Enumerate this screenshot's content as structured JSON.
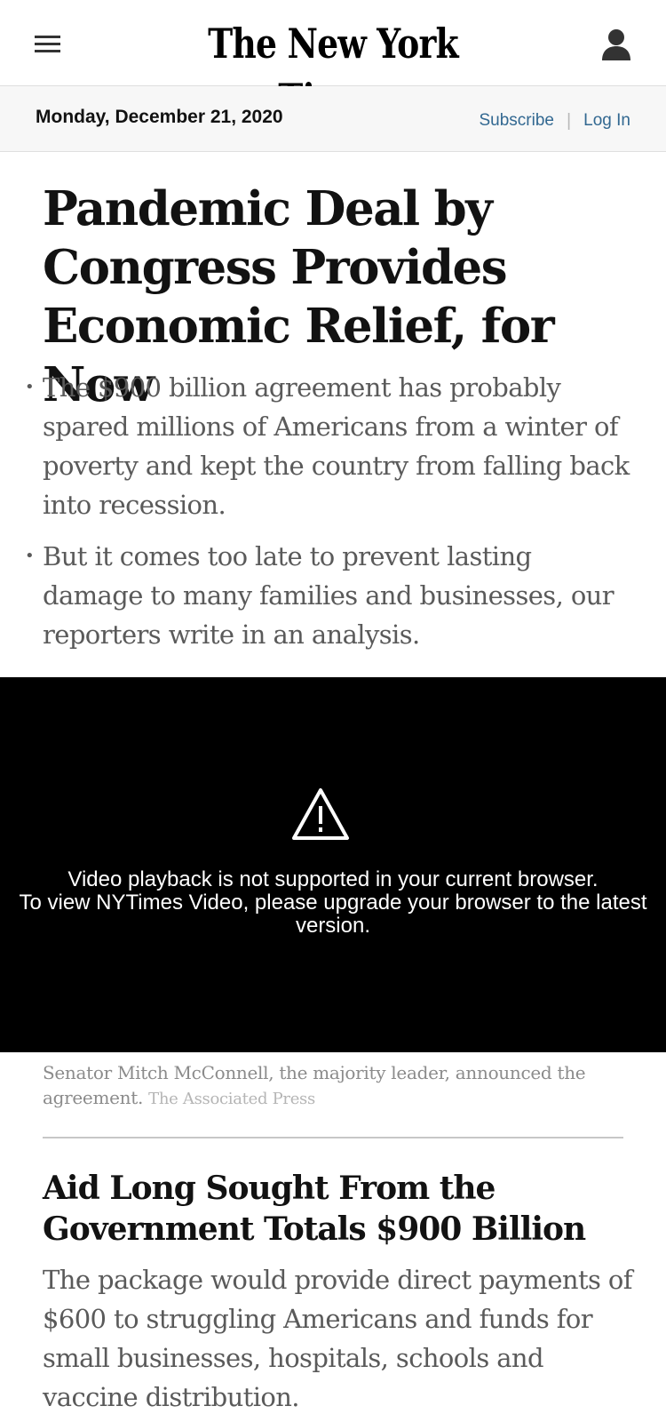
{
  "header": {
    "masthead": "The New York Times"
  },
  "datebar": {
    "date": "Monday, December 21, 2020",
    "subscribe": "Subscribe",
    "separator": "|",
    "login": "Log In"
  },
  "lead_story": {
    "headline": "Pandemic Deal by Congress Provides Economic Relief, for Now",
    "summary": [
      "The $900 billion agreement has probably spared millions of Americans from a winter of poverty and kept the country from falling back into recession.",
      "But it comes too late to prevent lasting damage to many families and businesses, our reporters write in an analysis."
    ]
  },
  "video": {
    "icon": "warning-icon",
    "message_line1": "Video playback is not supported in your current browser.",
    "message_line2": "To view NYTimes Video, please upgrade your browser to the latest version.",
    "caption": "Senator Mitch McConnell, the majority leader, announced the agreement.",
    "credit": "The Associated Press"
  },
  "second_story": {
    "headline": "Aid Long Sought From the Government Totals $900 Billion",
    "summary": "The package would provide direct payments of $600 to struggling Americans and funds for small businesses, hospitals, schools and vaccine distribution."
  },
  "colors": {
    "link": "#326891",
    "text": "#121212",
    "summary_text": "#5a5a5a"
  }
}
